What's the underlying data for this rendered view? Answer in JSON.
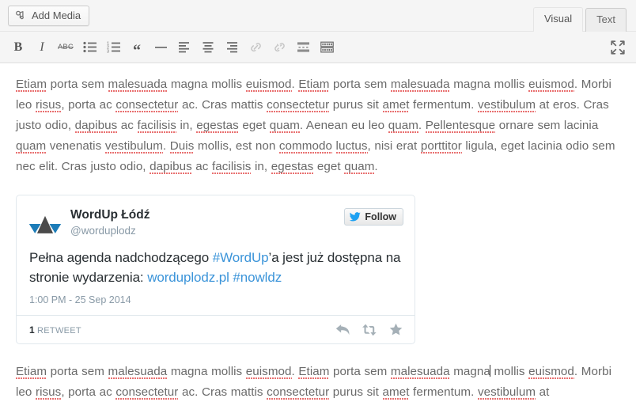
{
  "toolbar_top": {
    "add_media_label": "Add Media",
    "add_media_icon": "media-icon",
    "tabs": [
      {
        "label": "Visual",
        "active": true
      },
      {
        "label": "Text",
        "active": false
      }
    ]
  },
  "format_toolbar": {
    "buttons": [
      {
        "name": "bold",
        "glyph": "B",
        "title": "Bold",
        "disabled": false
      },
      {
        "name": "italic",
        "glyph": "I",
        "title": "Italic",
        "disabled": false
      },
      {
        "name": "strikethrough",
        "glyph": "ABC",
        "title": "Strikethrough",
        "disabled": false
      },
      {
        "name": "bullet-list",
        "glyph": "",
        "title": "Bulleted list",
        "disabled": false
      },
      {
        "name": "numbered-list",
        "glyph": "",
        "title": "Numbered list",
        "disabled": false
      },
      {
        "name": "blockquote",
        "glyph": "“",
        "title": "Blockquote",
        "disabled": false
      },
      {
        "name": "horizontal-rule",
        "glyph": "",
        "title": "Horizontal line",
        "disabled": false
      },
      {
        "name": "align-left",
        "glyph": "",
        "title": "Align left",
        "disabled": false
      },
      {
        "name": "align-center",
        "glyph": "",
        "title": "Align center",
        "disabled": false
      },
      {
        "name": "align-right",
        "glyph": "",
        "title": "Align right",
        "disabled": false
      },
      {
        "name": "insert-link",
        "glyph": "",
        "title": "Insert/edit link",
        "disabled": true
      },
      {
        "name": "remove-link",
        "glyph": "",
        "title": "Remove link",
        "disabled": true
      },
      {
        "name": "insert-more-tag",
        "glyph": "",
        "title": "Insert Read More tag",
        "disabled": false
      },
      {
        "name": "toolbar-toggle",
        "glyph": "",
        "title": "Toolbar Toggle",
        "disabled": false
      }
    ],
    "fullscreen_title": "Distraction-free writing mode"
  },
  "content": {
    "paragraph_1": {
      "runs": [
        {
          "t": "Etiam",
          "sp": true
        },
        {
          "t": " porta sem "
        },
        {
          "t": "malesuada",
          "sp": true
        },
        {
          "t": " magna mollis "
        },
        {
          "t": "euismod",
          "sp": true
        },
        {
          "t": ". "
        },
        {
          "t": "Etiam",
          "sp": true
        },
        {
          "t": " porta sem "
        },
        {
          "t": "malesuada",
          "sp": true
        },
        {
          "t": " magna mollis "
        },
        {
          "t": "euismod",
          "sp": true
        },
        {
          "t": ". Morbi leo "
        },
        {
          "t": "risus",
          "sp": true
        },
        {
          "t": ", porta ac "
        },
        {
          "t": "consectetur",
          "sp": true
        },
        {
          "t": " ac. Cras mattis "
        },
        {
          "t": "consectetur",
          "sp": true
        },
        {
          "t": " purus sit "
        },
        {
          "t": "amet",
          "sp": true
        },
        {
          "t": " fermentum. "
        },
        {
          "t": "vestibulum",
          "sp": true
        },
        {
          "t": " at eros. Cras justo odio, "
        },
        {
          "t": "dapibus",
          "sp": true
        },
        {
          "t": " ac "
        },
        {
          "t": "facilisis",
          "sp": true
        },
        {
          "t": " in, "
        },
        {
          "t": "egestas",
          "sp": true
        },
        {
          "t": " eget "
        },
        {
          "t": "quam",
          "sp": true
        },
        {
          "t": ". Aenean eu leo "
        },
        {
          "t": "quam",
          "sp": true
        },
        {
          "t": ". "
        },
        {
          "t": "Pellentesque",
          "sp": true
        },
        {
          "t": " ornare sem lacinia "
        },
        {
          "t": "quam",
          "sp": true
        },
        {
          "t": " venenatis "
        },
        {
          "t": "vestibulum",
          "sp": true
        },
        {
          "t": ". "
        },
        {
          "t": "Duis",
          "sp": true
        },
        {
          "t": " mollis, est non "
        },
        {
          "t": "commodo",
          "sp": true
        },
        {
          "t": " "
        },
        {
          "t": "luctus",
          "sp": true
        },
        {
          "t": ", nisi erat "
        },
        {
          "t": "porttitor",
          "sp": true
        },
        {
          "t": " ligula, eget lacinia odio sem nec elit. Cras justo odio, "
        },
        {
          "t": "dapibus",
          "sp": true
        },
        {
          "t": " ac "
        },
        {
          "t": "facilisis",
          "sp": true
        },
        {
          "t": " in, "
        },
        {
          "t": "egestas",
          "sp": true
        },
        {
          "t": " eget "
        },
        {
          "t": "quam",
          "sp": true
        },
        {
          "t": "."
        }
      ]
    },
    "paragraph_2": {
      "runs": [
        {
          "t": "Etiam",
          "sp": true
        },
        {
          "t": " porta sem "
        },
        {
          "t": "malesuada",
          "sp": true
        },
        {
          "t": " magna mollis "
        },
        {
          "t": "euismod",
          "sp": true
        },
        {
          "t": ". "
        },
        {
          "t": "Etiam",
          "sp": true
        },
        {
          "t": " porta sem "
        },
        {
          "t": "malesuada",
          "sp": true
        },
        {
          "t": " magna",
          "caret_after": true
        },
        {
          "t": " mollis "
        },
        {
          "t": "euismod",
          "sp": true
        },
        {
          "t": ". Morbi leo "
        },
        {
          "t": "risus",
          "sp": true
        },
        {
          "t": ", porta ac "
        },
        {
          "t": "consectetur",
          "sp": true
        },
        {
          "t": " ac. Cras mattis "
        },
        {
          "t": "consectetur",
          "sp": true
        },
        {
          "t": " purus sit "
        },
        {
          "t": "amet",
          "sp": true
        },
        {
          "t": " fermentum. "
        },
        {
          "t": "vestibulum",
          "sp": true
        },
        {
          "t": " at"
        }
      ]
    }
  },
  "tweet": {
    "full_name": "WordUp Łódź",
    "handle": "@worduplodz",
    "follow_label": "Follow",
    "avatar_name": "wordup-lodz-logo",
    "body_parts": [
      {
        "t": "Pełna agenda nadchodzącego ",
        "link": false
      },
      {
        "t": "#WordUp",
        "link": true
      },
      {
        "t": "’a jest już dostępna na stronie wydarzenia: ",
        "link": false
      },
      {
        "t": "worduplodz.pl",
        "link": true
      },
      {
        "t": " ",
        "link": false
      },
      {
        "t": "#nowldz",
        "link": true
      }
    ],
    "timestamp": "1:00 PM - 25 Sep 2014",
    "retweet_count": "1",
    "retweet_label": "RETWEET",
    "actions": [
      {
        "name": "reply-icon",
        "title": "Reply"
      },
      {
        "name": "retweet-icon",
        "title": "Retweet"
      },
      {
        "name": "favorite-icon",
        "title": "Favorite"
      }
    ]
  },
  "colors": {
    "twitter_blue": "#3b94d9",
    "logo_blue": "#1c7cb8",
    "logo_dark": "#4a4a4a",
    "spellcheck_red": "#e24040",
    "body_text": "#6a6a6a",
    "chrome_bg": "#f5f5f5"
  }
}
